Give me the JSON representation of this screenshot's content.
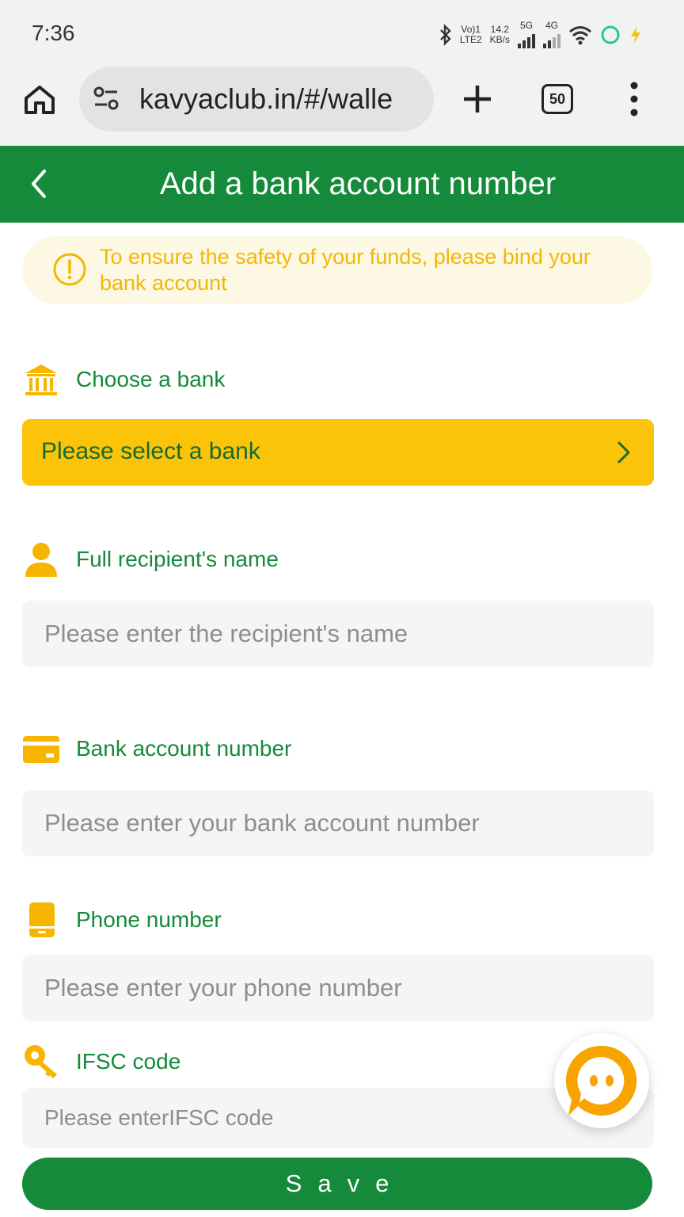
{
  "status_bar": {
    "time": "7:36",
    "volte_top": "Vo)1",
    "volte_bottom": "LTE2",
    "speed_top": "14.2",
    "speed_bottom": "KB/s",
    "net1": "5G",
    "net2": "4G"
  },
  "browser": {
    "url": "kavyaclub.in/#/walle",
    "tab_count": "50",
    "icons": [
      "home-icon",
      "site-settings-icon",
      "plus-icon",
      "tabs-icon",
      "more-vert-icon"
    ]
  },
  "header": {
    "title": "Add a bank account number",
    "back_icon": "chevron-left-icon"
  },
  "notice": {
    "text": "To ensure the safety of your funds, please bind your bank account",
    "icon": "alert-circle-icon"
  },
  "form": {
    "bank": {
      "label": "Choose a bank",
      "icon": "bank-icon",
      "select_text": "Please select a bank"
    },
    "name": {
      "label": "Full recipient's name",
      "icon": "user-icon",
      "placeholder": "Please enter the recipient's name"
    },
    "account": {
      "label": "Bank account number",
      "icon": "card-icon",
      "placeholder": "Please enter your bank account number"
    },
    "phone": {
      "label": "Phone number",
      "icon": "phone-icon",
      "placeholder": "Please enter your phone number"
    },
    "ifsc": {
      "label": "IFSC code",
      "icon": "key-icon",
      "placeholder": "Please enterIFSC code"
    },
    "save_label": "Save"
  },
  "colors": {
    "primary_green": "#148a3a",
    "accent_yellow": "#fcc408",
    "notice_text": "#f2b705",
    "notice_bg": "#fdf8e3",
    "chat_orange": "#f7a400"
  }
}
